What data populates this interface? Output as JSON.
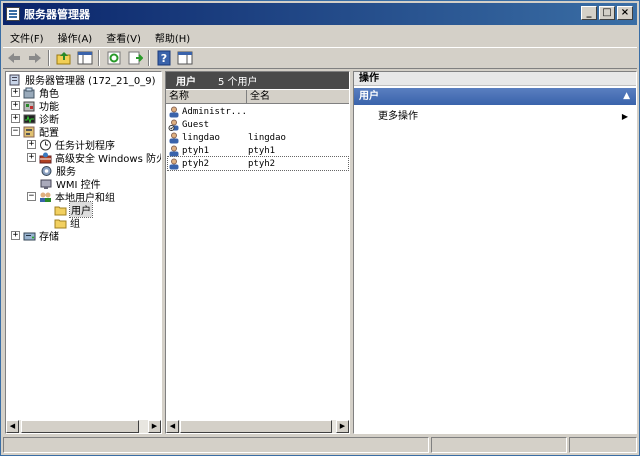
{
  "window": {
    "title": "服务器管理器",
    "controls": {
      "minimize": "_",
      "maximize": "□",
      "close": "×"
    }
  },
  "menu": [
    "文件(F)",
    "操作(A)",
    "查看(V)",
    "帮助(H)"
  ],
  "toolbar": [
    "back-icon",
    "forward-icon",
    "up-folder-icon",
    "show-hide-tree-icon",
    "refresh-icon",
    "export-list-icon",
    "help-icon",
    "show-hide-action-icon"
  ],
  "tree": {
    "root": "服务器管理器 (172_21_0_9)",
    "items": [
      {
        "label": "角色",
        "expander": "+",
        "icon": "roles-icon"
      },
      {
        "label": "功能",
        "expander": "+",
        "icon": "features-icon"
      },
      {
        "label": "诊断",
        "expander": "+",
        "icon": "diagnostics-icon"
      },
      {
        "label": "配置",
        "expander": "−",
        "icon": "configuration-icon"
      },
      {
        "label": "任务计划程序",
        "expander": "+",
        "icon": "task-scheduler-icon"
      },
      {
        "label": "高级安全 Windows 防火墙",
        "expander": "+",
        "icon": "firewall-icon"
      },
      {
        "label": "服务",
        "expander": "",
        "icon": "services-icon"
      },
      {
        "label": "WMI 控件",
        "expander": "",
        "icon": "wmi-icon"
      },
      {
        "label": "本地用户和组",
        "expander": "−",
        "icon": "users-groups-icon"
      },
      {
        "label": "用户",
        "expander": "",
        "icon": "folder-icon",
        "selected": true
      },
      {
        "label": "组",
        "expander": "",
        "icon": "folder-icon"
      },
      {
        "label": "存储",
        "expander": "+",
        "icon": "storage-icon"
      }
    ]
  },
  "list": {
    "header_title": "用户",
    "header_count": "5 个用户",
    "columns": [
      "名称",
      "全名"
    ],
    "rows": [
      {
        "name": "Administr...",
        "fullname": "",
        "icon": "user-icon"
      },
      {
        "name": "Guest",
        "fullname": "",
        "icon": "disabled-user-icon"
      },
      {
        "name": "lingdao",
        "fullname": "lingdao",
        "icon": "user-icon"
      },
      {
        "name": "ptyh1",
        "fullname": "ptyh1",
        "icon": "user-icon"
      },
      {
        "name": "ptyh2",
        "fullname": "ptyh2",
        "icon": "user-icon"
      }
    ]
  },
  "actions": {
    "header": "操作",
    "section": "用户",
    "collapse_glyph": "▲",
    "items": [
      {
        "label": "更多操作",
        "arrow": "▶"
      }
    ]
  },
  "scroll": {
    "left": "◀",
    "right": "▶"
  }
}
